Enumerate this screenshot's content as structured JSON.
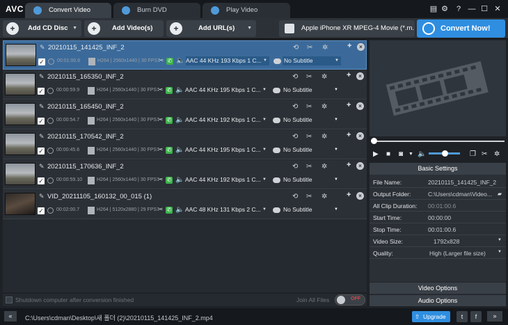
{
  "app": {
    "logo": "AVC"
  },
  "tabs": [
    {
      "label": "Convert Video",
      "active": true
    },
    {
      "label": "Burn DVD",
      "active": false
    },
    {
      "label": "Play Video",
      "active": false
    }
  ],
  "toolbar": {
    "add_cd": "Add CD Disc",
    "add_video": "Add Video(s)",
    "add_url": "Add URL(s)",
    "profile": "Apple iPhone XR MPEG-4 Movie (*.m...",
    "convert_now": "Convert Now!"
  },
  "files": [
    {
      "name": "20210115_141425_INF_2",
      "duration": "00:01:00.6",
      "codec": "H264",
      "resolution": "2560x1440",
      "fps": "30 FPS",
      "audio": "AAC 44 KHz 193 Kbps 1 C...",
      "subtitle": "No Subtitle",
      "selected": true
    },
    {
      "name": "20210115_165350_INF_2",
      "duration": "00:00:59.9",
      "codec": "H264",
      "resolution": "2560x1440",
      "fps": "30 FPS",
      "audio": "AAC 44 KHz 195 Kbps 1 C...",
      "subtitle": "No Subtitle",
      "selected": false
    },
    {
      "name": "20210115_165450_INF_2",
      "duration": "00:00:54.7",
      "codec": "H264",
      "resolution": "2560x1440",
      "fps": "30 FPS",
      "audio": "AAC 44 KHz 192 Kbps 1 C...",
      "subtitle": "No Subtitle",
      "selected": false
    },
    {
      "name": "20210115_170542_INF_2",
      "duration": "00:00:45.6",
      "codec": "H264",
      "resolution": "2560x1440",
      "fps": "30 FPS",
      "audio": "AAC 44 KHz 195 Kbps 1 C...",
      "subtitle": "No Subtitle",
      "selected": false
    },
    {
      "name": "20210115_170636_INF_2",
      "duration": "00:00:59.10",
      "codec": "H264",
      "resolution": "2560x1440",
      "fps": "30 FPS",
      "audio": "AAC 44 KHz 192 Kbps 1 C...",
      "subtitle": "No Subtitle",
      "selected": false
    },
    {
      "name": "VID_20211105_160132_00_015 (1)",
      "duration": "00:02:00.7",
      "codec": "H264",
      "resolution": "5120x2880",
      "fps": "29 FPS",
      "audio": "AAC 48 KHz 131 Kbps 2 C...",
      "subtitle": "No Subtitle",
      "selected": false
    }
  ],
  "footer": {
    "shutdown": "Shutdown computer after conversion finished",
    "join_all": "Join All Files",
    "join_state": "OFF"
  },
  "settings": {
    "title": "Basic Settings",
    "rows": [
      {
        "label": "File Name:",
        "value": "20210115_141425_INF_2"
      },
      {
        "label": "Output Folder:",
        "value": "C:\\Users\\cdman\\Video..."
      },
      {
        "label": "All Clip Duration:",
        "value": "00:01:00.6"
      },
      {
        "label": "Start Time:",
        "value": "00:00:00"
      },
      {
        "label": "Stop Time:",
        "value": "00:01:00.6"
      },
      {
        "label": "Video Size:",
        "value": "1792x828"
      },
      {
        "label": "Quality:",
        "value": "High (Larger file size)"
      }
    ],
    "video_options": "Video Options",
    "audio_options": "Audio Options"
  },
  "status": {
    "output_path": "C:\\Users\\cdman\\Desktop\\새 폴더 (2)\\20210115_141425_INF_2.mp4",
    "upgrade": "Upgrade"
  },
  "colors": {
    "accent": "#2f8ee0",
    "selected_row": "#3b6a9a",
    "toggle_off": "#d24a4a"
  }
}
